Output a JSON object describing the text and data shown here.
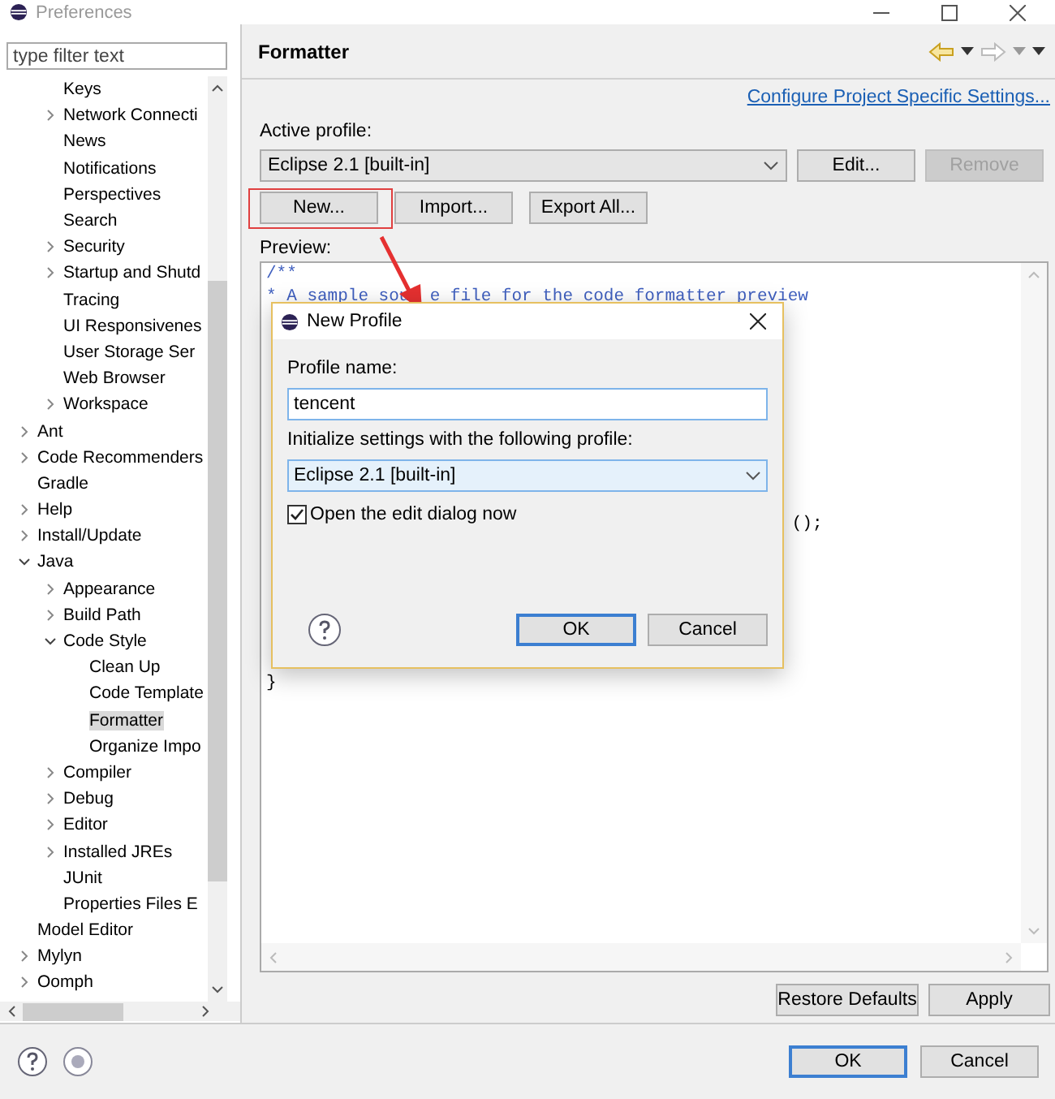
{
  "window": {
    "title": "Preferences"
  },
  "sidebar": {
    "filter": {
      "placeholder": "type filter text"
    },
    "tree": [
      {
        "children": [
          {
            "label": "Keys",
            "selected": false
          },
          {
            "label": "Network Connecti",
            "selected": false,
            "expanded": false
          },
          {
            "label": "News",
            "selected": false
          },
          {
            "label": "Notifications",
            "selected": false
          },
          {
            "label": "Perspectives",
            "selected": false
          },
          {
            "label": "Search",
            "selected": false
          },
          {
            "label": "Security",
            "selected": false,
            "expanded": false
          },
          {
            "label": "Startup and Shutd",
            "selected": false,
            "expanded": false
          },
          {
            "label": "Tracing",
            "selected": false
          },
          {
            "label": "UI Responsivenes",
            "selected": false
          },
          {
            "label": "User Storage Ser",
            "selected": false
          },
          {
            "label": "Web Browser",
            "selected": false
          },
          {
            "label": "Workspace",
            "selected": false,
            "expanded": false
          }
        ]
      },
      {
        "label": "Ant",
        "selected": false,
        "expanded": false
      },
      {
        "label": "Code Recommenders",
        "selected": false,
        "expanded": false
      },
      {
        "label": "Gradle",
        "selected": false
      },
      {
        "label": "Help",
        "selected": false,
        "expanded": false
      },
      {
        "label": "Install/Update",
        "selected": false,
        "expanded": false
      },
      {
        "label": "Java",
        "selected": false,
        "expanded": true,
        "children": [
          {
            "label": "Appearance",
            "selected": false,
            "expanded": false
          },
          {
            "label": "Build Path",
            "selected": false,
            "expanded": false
          },
          {
            "label": "Code Style",
            "selected": false,
            "expanded": true,
            "children": [
              {
                "label": "Clean Up",
                "selected": false
              },
              {
                "label": "Code Template",
                "selected": false
              },
              {
                "label": "Formatter",
                "selected": true
              },
              {
                "label": "Organize Impo",
                "selected": false
              }
            ]
          },
          {
            "label": "Compiler",
            "selected": false,
            "expanded": false
          },
          {
            "label": "Debug",
            "selected": false,
            "expanded": false
          },
          {
            "label": "Editor",
            "selected": false,
            "expanded": false
          },
          {
            "label": "Installed JREs",
            "selected": false,
            "expanded": false
          },
          {
            "label": "JUnit",
            "selected": false
          },
          {
            "label": "Properties Files E",
            "selected": false
          }
        ]
      },
      {
        "label": "Model Editor",
        "selected": false
      },
      {
        "label": "Mylyn",
        "selected": false,
        "expanded": false
      },
      {
        "label": "Oomph",
        "selected": false,
        "expanded": false
      }
    ]
  },
  "page": {
    "title": "Formatter",
    "link": "Configure Project Specific Settings...",
    "active_profile_label": "Active profile:",
    "active_profile": "Eclipse 2.1 [built-in]",
    "edit_button": "Edit...",
    "remove_button": {
      "label": "Remove",
      "disabled": true
    },
    "profile_buttons": [
      "New...",
      "Import...",
      "Export All..."
    ],
    "preview_label": "Preview:",
    "preview_lines": [
      {
        "kind": "comment",
        "text": "/**"
      },
      {
        "kind": "comment",
        "text": "* A sample sou",
        "tail": "e file for the code formatter preview"
      },
      {
        "kind": "blank"
      },
      {
        "kind": "blank"
      },
      {
        "kind": "blank"
      },
      {
        "kind": "blank"
      },
      {
        "kind": "blank"
      },
      {
        "kind": "blank"
      },
      {
        "kind": "blank"
      },
      {
        "kind": "blank"
      },
      {
        "kind": "blank"
      },
      {
        "kind": "plain",
        "tail": "();"
      },
      {
        "kind": "blank"
      },
      {
        "kind": "blank"
      },
      {
        "kind": "blank"
      },
      {
        "kind": "blank"
      },
      {
        "kind": "blank"
      },
      {
        "kind": "blank"
      },
      {
        "kind": "plain",
        "text": "}"
      }
    ],
    "restore_button": "Restore Defaults",
    "apply_button": "Apply"
  },
  "dialog": {
    "title": "New Profile",
    "name_label": "Profile name:",
    "name_value": "tencent",
    "init_label": "Initialize settings with the following profile:",
    "init_profile": "Eclipse 2.1 [built-in]",
    "open_edit": {
      "label": "Open the edit dialog now",
      "checked": true
    },
    "ok_button": "OK",
    "cancel_button": "Cancel"
  },
  "footer": {
    "ok_button": "OK",
    "cancel_button": "Cancel"
  }
}
